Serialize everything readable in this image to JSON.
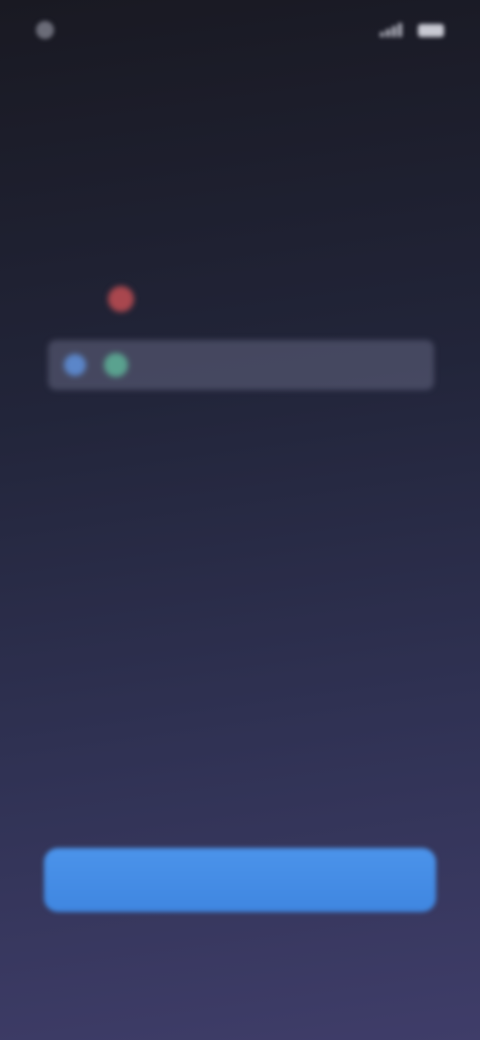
{
  "status_bar": {
    "time": "",
    "battery": ""
  },
  "prompt": {
    "text": ""
  },
  "options": [
    {
      "label": "",
      "icon": "red-circle-icon",
      "color": "#a9474e",
      "selected": false
    },
    {
      "label": "",
      "icon": "blue-green-circle-icons",
      "color": "#5aa28f",
      "selected": true
    },
    {
      "label": "",
      "icon": "",
      "selected": false
    }
  ],
  "primary_button": {
    "label": "",
    "color": "#4b93ea"
  },
  "footer": {
    "link_label": ""
  }
}
